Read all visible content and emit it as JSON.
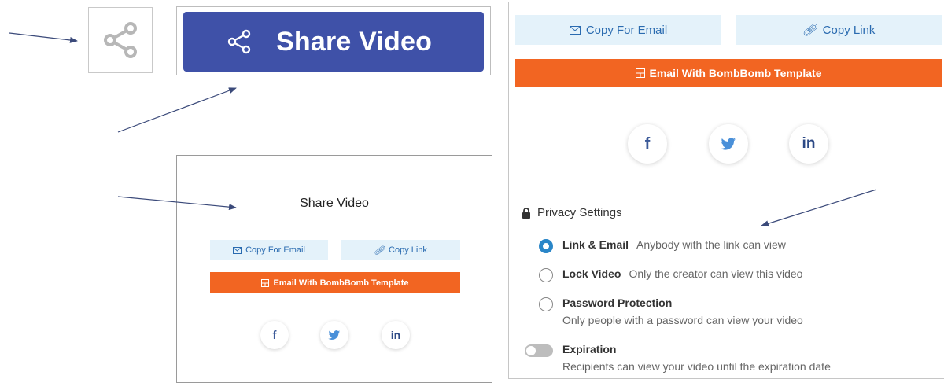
{
  "share_button": {
    "label": "Share Video"
  },
  "small_dialog": {
    "title": "Share Video",
    "copy_email": "Copy For Email",
    "copy_link": "Copy Link",
    "bombbomb": "Email With BombBomb Template",
    "social": {
      "facebook": "f",
      "linkedin": "in"
    }
  },
  "large_panel": {
    "copy_email": "Copy For Email",
    "copy_link": "Copy Link",
    "bombbomb": "Email With BombBomb Template",
    "social": {
      "facebook": "f",
      "linkedin": "in"
    },
    "privacy": {
      "title": "Privacy Settings",
      "link_email": {
        "name": "Link & Email",
        "desc": "Anybody with the link can view",
        "selected": true
      },
      "lock_video": {
        "name": "Lock Video",
        "desc": "Only the creator can view this video",
        "selected": false
      },
      "password": {
        "name": "Password Protection",
        "desc": "Only people with a password can view your video",
        "selected": false
      },
      "expiration": {
        "name": "Expiration",
        "desc": "Recipients can view your video until the expiration date",
        "enabled": false
      }
    }
  },
  "colors": {
    "share_blue": "#3f51a8",
    "orange": "#f26522",
    "light_blue": "#e4f2fa",
    "link_blue": "#2a6bb0",
    "arrow": "#3b4a7a"
  },
  "icons": [
    "share-icon",
    "envelope-icon",
    "link-icon",
    "template-icon",
    "facebook-icon",
    "twitter-icon",
    "linkedin-icon",
    "lock-icon"
  ]
}
